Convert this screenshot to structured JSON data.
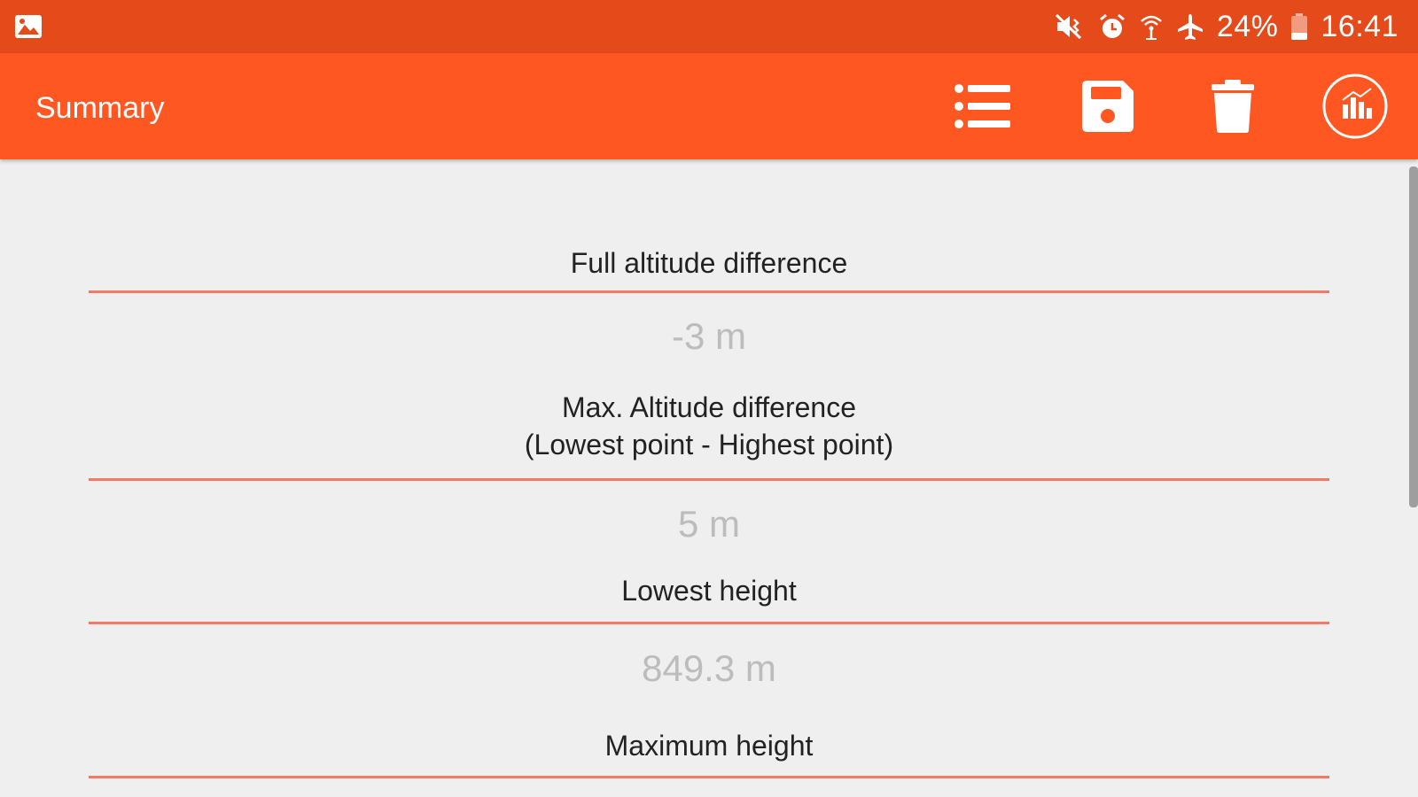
{
  "status_bar": {
    "battery_percent": "24%",
    "time": "16:41",
    "icons": [
      "gallery-icon",
      "vibrate-mute-icon",
      "alarm-icon",
      "wifi-calling-icon",
      "airplane-icon",
      "battery-icon"
    ]
  },
  "toolbar": {
    "title": "Summary",
    "actions": [
      "list-icon",
      "save-icon",
      "delete-icon",
      "chart-icon"
    ]
  },
  "summary": {
    "full_altitude_label": "Full altitude difference",
    "full_altitude_value": "-3 m",
    "max_altitude_label_line1": "Max. Altitude difference",
    "max_altitude_label_line2": "(Lowest point - Highest point)",
    "max_altitude_value": "5 m",
    "lowest_height_label": "Lowest height",
    "lowest_height_value": "849.3 m",
    "maximum_height_label": "Maximum height"
  },
  "colors": {
    "status_bar": "#e54a1a",
    "toolbar": "#ff5722",
    "divider": "#f27b68",
    "background": "#efefef",
    "value_text": "#bcbcbc"
  }
}
